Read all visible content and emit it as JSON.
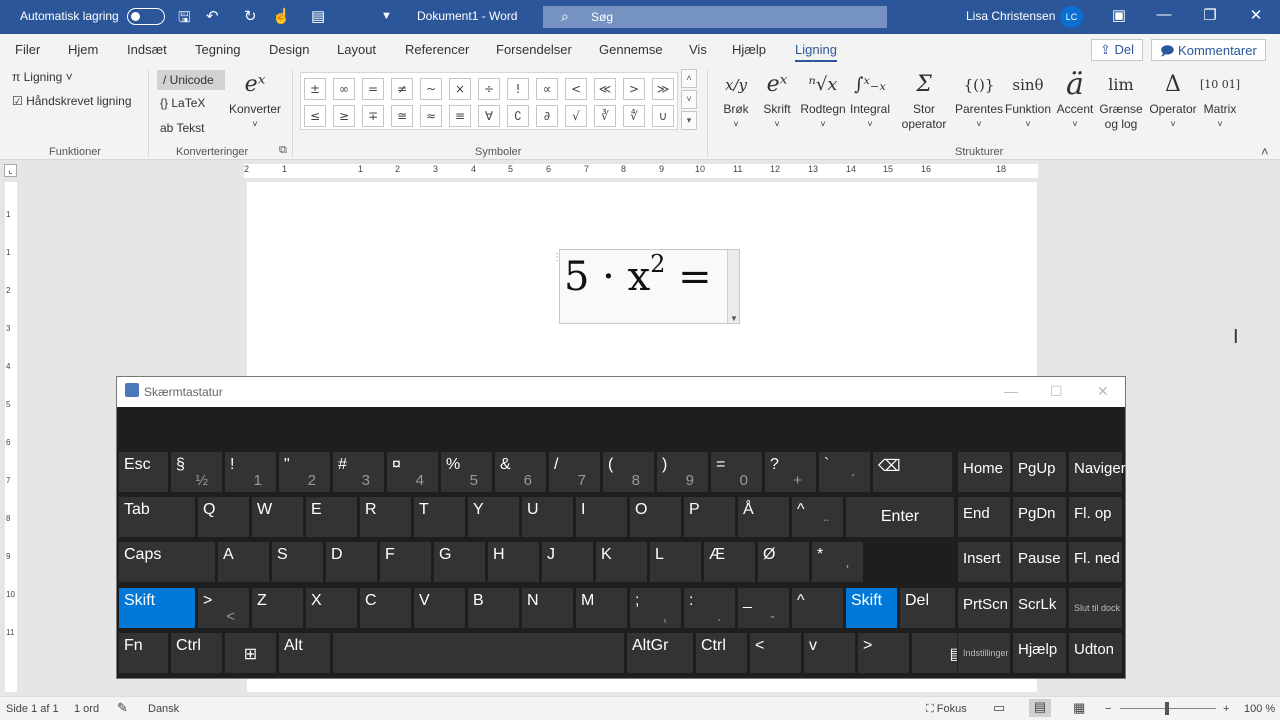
{
  "titlebar": {
    "autosave_label": "Automatisk lagring",
    "doc_title": "Dokument1  -  Word",
    "search_placeholder": "Søg",
    "user_name": "Lisa Christensen",
    "user_initials": "LC"
  },
  "menu": {
    "tabs": [
      "Filer",
      "Hjem",
      "Indsæt",
      "Tegning",
      "Design",
      "Layout",
      "Referencer",
      "Forsendelser",
      "Gennemse",
      "Vis",
      "Hjælp",
      "Ligning"
    ],
    "share_label": "Del",
    "comments_label": "Kommentarer"
  },
  "ribbon": {
    "functions": {
      "equation": "Ligning",
      "handwritten": "Håndskrevet ligning",
      "group": "Funktioner"
    },
    "conversions": {
      "unicode": "Unicode",
      "latex": "LaTeX",
      "text": "Tekst",
      "convert": "Konverter",
      "group": "Konverteringer"
    },
    "symbols": {
      "row1": [
        "±",
        "∞",
        "=",
        "≠",
        "~",
        "×",
        "÷",
        "!",
        "∝",
        "<",
        "≪",
        ">",
        "≫"
      ],
      "row2": [
        "≤",
        "≥",
        "∓",
        "≅",
        "≈",
        "≡",
        "∀",
        "∁",
        "∂",
        "√",
        "∛",
        "∜",
        "∪"
      ],
      "group": "Symboler"
    },
    "structures": {
      "items": [
        {
          "label": "Brøk",
          "icon": "x/y"
        },
        {
          "label": "Skrift",
          "icon": "eˣ"
        },
        {
          "label": "Rodtegn",
          "icon": "ⁿ√x"
        },
        {
          "label": "Integral",
          "icon": "∫ˣ₋ₓ"
        },
        {
          "label": "Stor operator",
          "icon": "Σ"
        },
        {
          "label": "Parentes",
          "icon": "{()}"
        },
        {
          "label": "Funktion",
          "icon": "sinθ"
        },
        {
          "label": "Accent",
          "icon": "ä"
        },
        {
          "label": "Grænse og log",
          "icon": "lim"
        },
        {
          "label": "Operator",
          "icon": "Δ"
        },
        {
          "label": "Matrix",
          "icon": "[10 01]"
        }
      ],
      "group": "Strukturer"
    }
  },
  "ruler": {
    "h_numbers": [
      "2",
      "1",
      "1",
      "2",
      "3",
      "4",
      "5",
      "6",
      "7",
      "8",
      "9",
      "10",
      "11",
      "12",
      "13",
      "14",
      "15",
      "16",
      "18"
    ],
    "v_numbers": [
      "1",
      "1",
      "2",
      "3",
      "4",
      "5",
      "6",
      "7",
      "8",
      "9",
      "10",
      "11"
    ]
  },
  "document": {
    "equation": {
      "base": "5 · x",
      "exponent": "2",
      "suffix": " ="
    }
  },
  "osk": {
    "title": "Skærmtastatur",
    "rows": [
      [
        {
          "t": "Esc"
        },
        {
          "t": "§",
          "b": "½"
        },
        {
          "t": "!",
          "b": "1"
        },
        {
          "t": "\"",
          "b": "2"
        },
        {
          "t": "#",
          "b": "3"
        },
        {
          "t": "¤",
          "b": "4"
        },
        {
          "t": "%",
          "b": "5"
        },
        {
          "t": "&",
          "b": "6"
        },
        {
          "t": "/",
          "b": "7"
        },
        {
          "t": "(",
          "b": "8"
        },
        {
          "t": ")",
          "b": "9"
        },
        {
          "t": "=",
          "b": "0"
        },
        {
          "t": "?",
          "b": "+"
        },
        {
          "t": "`",
          "b": "´"
        },
        {
          "t": "⌫"
        }
      ],
      [
        {
          "t": "Tab"
        },
        {
          "t": "Q"
        },
        {
          "t": "W"
        },
        {
          "t": "E"
        },
        {
          "t": "R"
        },
        {
          "t": "T"
        },
        {
          "t": "Y"
        },
        {
          "t": "U"
        },
        {
          "t": "I"
        },
        {
          "t": "O"
        },
        {
          "t": "P"
        },
        {
          "t": "Å"
        },
        {
          "t": "^",
          "b": "¨"
        },
        {
          "c": "Enter"
        }
      ],
      [
        {
          "t": "Caps"
        },
        {
          "t": "A"
        },
        {
          "t": "S"
        },
        {
          "t": "D"
        },
        {
          "t": "F"
        },
        {
          "t": "G"
        },
        {
          "t": "H"
        },
        {
          "t": "J"
        },
        {
          "t": "K"
        },
        {
          "t": "L"
        },
        {
          "t": "Æ"
        },
        {
          "t": "Ø"
        },
        {
          "t": "*",
          "b": "'"
        }
      ],
      [
        {
          "t": "Skift"
        },
        {
          "t": ">",
          "b": "<"
        },
        {
          "t": "Z"
        },
        {
          "t": "X"
        },
        {
          "t": "C"
        },
        {
          "t": "V"
        },
        {
          "t": "B"
        },
        {
          "t": "N"
        },
        {
          "t": "M"
        },
        {
          "t": ";",
          "b": ","
        },
        {
          "t": ":",
          "b": "."
        },
        {
          "t": "_",
          "b": "-"
        },
        {
          "t": "^"
        },
        {
          "t": "Skift"
        },
        {
          "t": "Del"
        }
      ],
      [
        {
          "t": "Fn"
        },
        {
          "t": "Ctrl"
        },
        {
          "c": "⊞"
        },
        {
          "t": "Alt"
        },
        {
          "t": ""
        },
        {
          "t": "AltGr"
        },
        {
          "t": "Ctrl"
        },
        {
          "t": "<"
        },
        {
          "t": "v"
        },
        {
          "t": ">"
        },
        {
          "c": "▤"
        }
      ]
    ],
    "nav": [
      [
        "Home",
        "PgUp",
        "Naviger"
      ],
      [
        "End",
        "PgDn",
        "Fl. op"
      ],
      [
        "Insert",
        "Pause",
        "Fl. ned"
      ],
      [
        "PrtScn",
        "ScrLk",
        "Slut til dock"
      ],
      [
        "Indstillinger",
        "Hjælp",
        "Udton"
      ]
    ]
  },
  "status": {
    "page": "Side 1 af 1",
    "words": "1 ord",
    "language": "Dansk",
    "focus": "Fokus",
    "zoom": "100 %"
  }
}
